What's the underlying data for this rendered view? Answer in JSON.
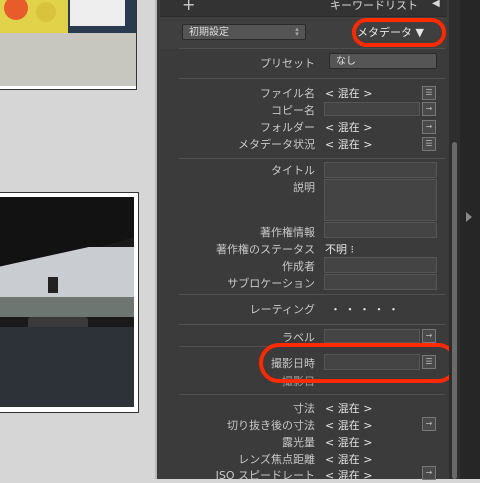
{
  "header": {
    "add_label": "+",
    "title": "キーワードリスト",
    "collapse_icon": "◀"
  },
  "toolbar": {
    "preset_select_value": "初期設定",
    "metadata_menu_label": "メタデータ ▼"
  },
  "preset": {
    "label": "プリセット",
    "value": "なし"
  },
  "file_section": [
    {
      "label": "ファイル名",
      "value": "< 混在 >"
    },
    {
      "label": "コピー名",
      "value": ""
    },
    {
      "label": "フォルダー",
      "value": "< 混在 >"
    },
    {
      "label": "メタデータ状況",
      "value": "< 混在 >"
    }
  ],
  "iptc_section": [
    {
      "label": "タイトル"
    },
    {
      "label": "説明"
    },
    {
      "label": "著作権情報"
    },
    {
      "label": "著作権のステータス",
      "value": "不明 ⁝"
    },
    {
      "label": "作成者"
    },
    {
      "label": "サブロケーション"
    }
  ],
  "rating": {
    "label": "レーティング",
    "value": "・ ・ ・ ・ ・"
  },
  "label_field": {
    "label": "ラベル"
  },
  "capture": {
    "label": "撮影日時",
    "partial_label": "撮影日"
  },
  "exif_section": [
    {
      "label": "寸法",
      "value": "< 混在 >"
    },
    {
      "label": "切り抜き後の寸法",
      "value": "< 混在 >"
    },
    {
      "label": "露光量",
      "value": "< 混在 >"
    },
    {
      "label": "レンズ焦点距離",
      "value": "< 混在 >"
    },
    {
      "label": "ISO スピードレート",
      "value": "< 混在 >"
    }
  ],
  "colors": {
    "panel": "#3b3b3b",
    "highlight": "#ff2a00"
  }
}
